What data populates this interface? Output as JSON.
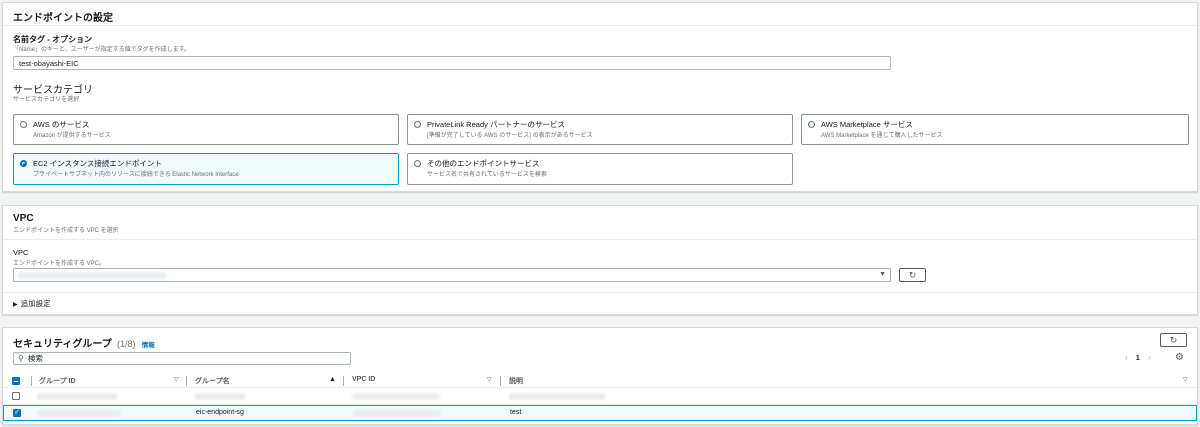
{
  "endpoint": {
    "title": "エンドポイントの設定",
    "name_tag": {
      "label": "名前タグ - オプション",
      "description": "「Name」のキーと、ユーザーが指定する値でタグを作成します。",
      "value": "test-obayashi-EIC"
    },
    "category": {
      "heading": "サービスカテゴリ",
      "description": "サービスカテゴリを選択",
      "options": [
        {
          "title": "AWS のサービス",
          "desc": "Amazon が提供するサービス",
          "selected": false
        },
        {
          "title": "PrivateLink Ready パートナーのサービス",
          "desc": "[準備が完了している AWS のサービス] の表示があるサービス",
          "selected": false
        },
        {
          "title": "AWS Marketplace サービス",
          "desc": "AWS Marketplace を通じて購入したサービス",
          "selected": false
        },
        {
          "title": "EC2 インスタンス接続エンドポイント",
          "desc": "プライベートサブネット内のリソースに接続できる Elastic Network Interface",
          "selected": true
        },
        {
          "title": "その他のエンドポイントサービス",
          "desc": "サービス名で共有されているサービスを検索",
          "selected": false
        }
      ]
    }
  },
  "vpc": {
    "title": "VPC",
    "description": "エンドポイントを作成する VPC を選択",
    "field_label": "VPC",
    "field_desc": "エンドポイントを作成する VPC。",
    "dropdown_icon": "caret-down-icon",
    "refresh_icon": "refresh-icon",
    "additional_settings": "追加設定"
  },
  "security_groups": {
    "title": "セキュリティグループ",
    "count": "(1/8)",
    "info_link": "情報",
    "search_placeholder": "検索",
    "pagination": {
      "prev": "‹",
      "page": "1",
      "next": "›"
    },
    "columns": [
      "グループ ID",
      "グループ名",
      "VPC ID",
      "説明"
    ],
    "rows": [
      {
        "selected": false,
        "group_name": "",
        "description": ""
      },
      {
        "selected": true,
        "group_name": "eic-endpoint-sg",
        "description": "test"
      }
    ]
  },
  "colors": {
    "accent": "#0073bb",
    "selected_border": "#00a1c9",
    "selected_bg": "#f1faff"
  }
}
